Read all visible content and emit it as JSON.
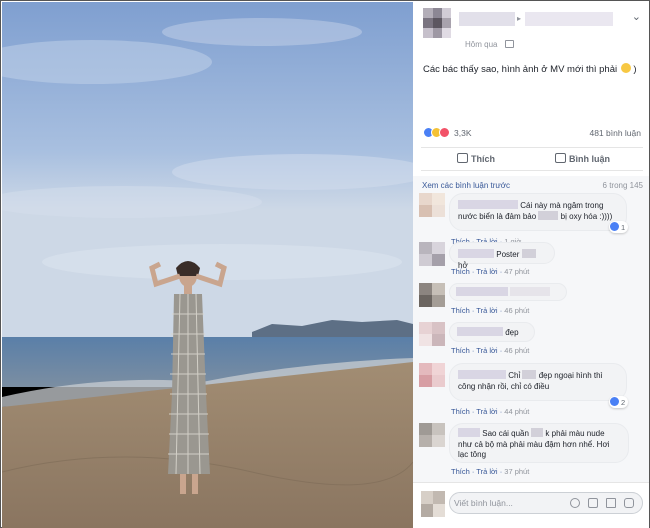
{
  "post": {
    "time_label": "Hôm qua",
    "caption": "Các bác thấy sao, hình ảnh ở MV mới thì phải",
    "caption_end": ")",
    "reaction_count": "3,3K",
    "comment_count": "481 bình luận",
    "actions": {
      "like": "Thích",
      "comment": "Bình luận"
    }
  },
  "comments_section": {
    "view_previous": "Xem các bình luận trước",
    "shown_count": "6 trong 145",
    "comments": [
      {
        "text_1": "Cái này mà ngâm trong",
        "text_2": "nước biển là đảm bảo",
        "text_3": "bị oxy hóa :))))",
        "like": "Thích",
        "reply": "Trả lời",
        "time": "1 giờ",
        "reactions": "1"
      },
      {
        "text_1": "Poster",
        "text_2": "hở",
        "like": "Thích",
        "reply": "Trả lời",
        "time": "47 phút"
      },
      {
        "like": "Thích",
        "reply": "Trả lời",
        "time": "46 phút"
      },
      {
        "text_1": "đẹp",
        "like": "Thích",
        "reply": "Trả lời",
        "time": "46 phút"
      },
      {
        "text_1": "Chỉ",
        "text_2": "đẹp ngoại hình thì",
        "text_3": "công nhận rồi, chỉ có điều",
        "like": "Thích",
        "reply": "Trả lời",
        "time": "44 phút",
        "reactions": "2"
      },
      {
        "text_1": "Sao cái quần",
        "text_2": "k phải màu nude",
        "text_3": "như cả bộ mà phải màu đậm hơn nhể. Hơi",
        "text_4": "lạc tông",
        "like": "Thích",
        "reply": "Trả lời",
        "time": "37 phút"
      }
    ]
  },
  "composer": {
    "placeholder": "Viết bình luận..."
  },
  "colors": {
    "link": "#385898",
    "muted": "#90949c",
    "accent": "#4a80f5"
  },
  "icons": [
    "chevron-down-icon",
    "globe-icon",
    "like-icon",
    "comment-icon",
    "emoji-icon",
    "camera-icon",
    "gif-icon",
    "sticker-icon"
  ]
}
